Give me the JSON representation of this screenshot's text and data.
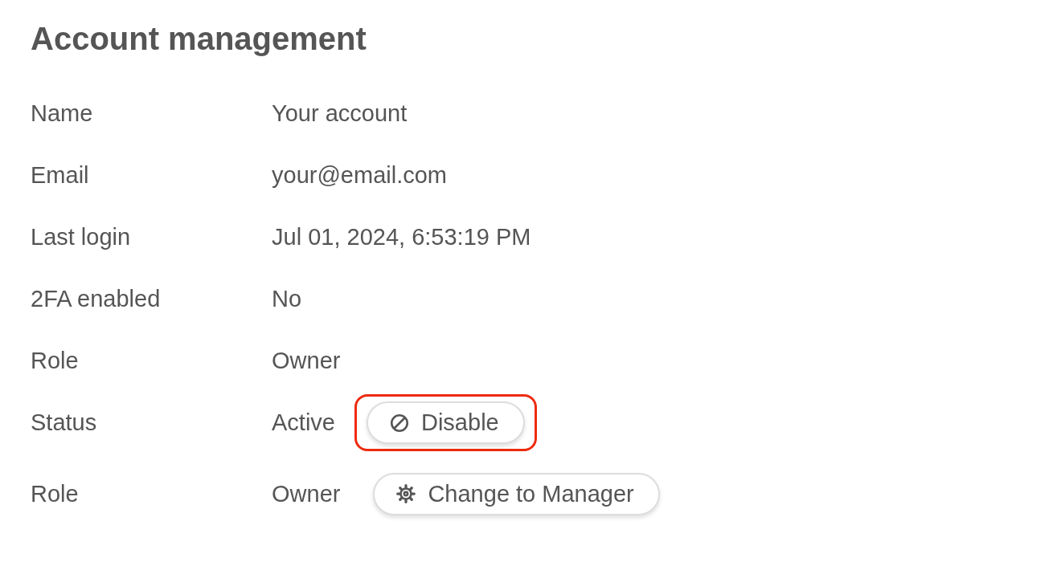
{
  "title": "Account management",
  "rows": [
    {
      "label": "Name",
      "value": "Your account"
    },
    {
      "label": "Email",
      "value": "your@email.com"
    },
    {
      "label": "Last login",
      "value": "Jul 01, 2024, 6:53:19 PM"
    },
    {
      "label": "2FA enabled",
      "value": "No"
    },
    {
      "label": "Role",
      "value": "Owner"
    },
    {
      "label": "Status",
      "value": "Active",
      "button": {
        "label": "Disable",
        "kind": "disable",
        "highlighted": true
      }
    },
    {
      "label": "Role",
      "value": "Owner",
      "button": {
        "label": "Change to Manager",
        "kind": "change-role",
        "highlighted": false
      }
    }
  ]
}
